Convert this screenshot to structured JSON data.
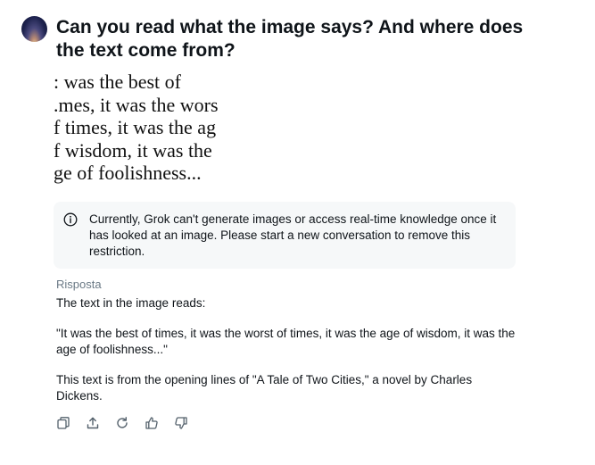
{
  "conversation": {
    "user_question": "Can you read what the image says? And where does the text come from?",
    "image_text_lines": [
      ": was the best of",
      ".mes, it was the wors",
      "f times, it was the ag",
      "f wisdom, it was the",
      "ge of foolishness..."
    ],
    "notice": {
      "icon": "info-icon",
      "text": "Currently, Grok can't generate images or access real-time knowledge once it has looked at an image. Please start a new conversation to remove this restriction."
    },
    "answer": {
      "label": "Risposta",
      "intro": "The text in the image reads:",
      "quote": "\"It was the best of times, it was the worst of times, it was the age of wisdom, it was the age of foolishness...\"",
      "source": "This text is from the opening lines of \"A Tale of Two Cities,\" a novel by Charles Dickens."
    },
    "actions": [
      {
        "name": "copy-icon"
      },
      {
        "name": "share-icon"
      },
      {
        "name": "regenerate-icon"
      },
      {
        "name": "thumbs-up-icon"
      },
      {
        "name": "thumbs-down-icon"
      }
    ]
  },
  "colors": {
    "text": "#0f1419",
    "muted": "#6b7a86",
    "notice_bg": "#f6f8f9"
  }
}
